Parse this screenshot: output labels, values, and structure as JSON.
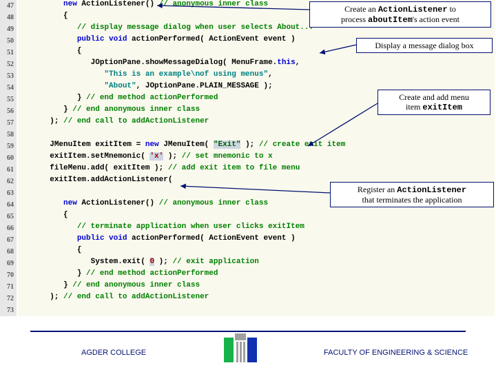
{
  "gutter": {
    "start": 47,
    "end": 73
  },
  "code": {
    "47": [
      [
        "",
        10
      ],
      [
        "kw",
        "new"
      ],
      [
        "id",
        " ActionListener() "
      ],
      [
        "cm",
        "// anonymous inner class"
      ]
    ],
    "48": [
      [
        "",
        10
      ],
      [
        "pun",
        "{"
      ]
    ],
    "49": [
      [
        "",
        13
      ],
      [
        "cm",
        "// display message dialog when user selects About..."
      ]
    ],
    "50": [
      [
        "",
        13
      ],
      [
        "kw",
        "public void"
      ],
      [
        "id",
        " actionPerformed( ActionEvent event )"
      ]
    ],
    "51": [
      [
        "",
        13
      ],
      [
        "pun",
        "{"
      ]
    ],
    "52": [
      [
        "",
        16
      ],
      [
        "id",
        "JOptionPane.showMessageDialog( MenuFrame."
      ],
      [
        "kw",
        "this"
      ],
      [
        "pun",
        ","
      ]
    ],
    "53": [
      [
        "",
        19
      ],
      [
        "str",
        "\"This is an example\\nof using menus\""
      ],
      [
        "pun",
        ","
      ]
    ],
    "54": [
      [
        "",
        19
      ],
      [
        "str",
        "\"About\""
      ],
      [
        "pun",
        ", JOptionPane.PLAIN_MESSAGE );"
      ]
    ],
    "55": [
      [
        "",
        13
      ],
      [
        "pun",
        "} "
      ],
      [
        "cm",
        "// end method actionPerformed"
      ]
    ],
    "56": [
      [
        "",
        10
      ],
      [
        "pun",
        "} "
      ],
      [
        "cm",
        "// end anonymous inner class"
      ]
    ],
    "57": [
      [
        "",
        7
      ],
      [
        "pun",
        "); "
      ],
      [
        "cm",
        "// end call to addActionListener"
      ]
    ],
    "58": [
      [
        "",
        0
      ]
    ],
    "59": [
      [
        "",
        7
      ],
      [
        "id",
        "JMenuItem exitItem = "
      ],
      [
        "kw",
        "new"
      ],
      [
        "id",
        " JMenuItem( "
      ],
      [
        "hlg",
        "\"Exit\""
      ],
      [
        "id",
        " ); "
      ],
      [
        "cm",
        "// create exit item"
      ]
    ],
    "60": [
      [
        "",
        7
      ],
      [
        "id",
        "exitItem.setMnemonic( "
      ],
      [
        "hl",
        "'x'"
      ],
      [
        "id",
        " ); "
      ],
      [
        "cm",
        "// set mnemonic to x"
      ]
    ],
    "61": [
      [
        "",
        7
      ],
      [
        "id",
        "fileMenu.add( exitItem ); "
      ],
      [
        "cm",
        "// add exit item to file menu"
      ]
    ],
    "62": [
      [
        "",
        7
      ],
      [
        "id",
        "exitItem.addActionListener("
      ]
    ],
    "63": [
      [
        "",
        0
      ]
    ],
    "64": [
      [
        "",
        10
      ],
      [
        "kw",
        "new"
      ],
      [
        "id",
        " ActionListener() "
      ],
      [
        "cm",
        "// anonymous inner class"
      ]
    ],
    "65": [
      [
        "",
        10
      ],
      [
        "pun",
        "{"
      ]
    ],
    "66": [
      [
        "",
        13
      ],
      [
        "cm",
        "// terminate application when user clicks exitItem"
      ]
    ],
    "67": [
      [
        "",
        13
      ],
      [
        "kw",
        "public void"
      ],
      [
        "id",
        " actionPerformed( ActionEvent event )"
      ]
    ],
    "68": [
      [
        "",
        13
      ],
      [
        "pun",
        "{"
      ]
    ],
    "69": [
      [
        "",
        16
      ],
      [
        "id",
        "System.exit( "
      ],
      [
        "hl",
        "0"
      ],
      [
        "id",
        " ); "
      ],
      [
        "cm",
        "// exit application"
      ]
    ],
    "70": [
      [
        "",
        13
      ],
      [
        "pun",
        "} "
      ],
      [
        "cm",
        "// end method actionPerformed"
      ]
    ],
    "71": [
      [
        "",
        10
      ],
      [
        "pun",
        "} "
      ],
      [
        "cm",
        "// end anonymous inner class"
      ]
    ],
    "72": [
      [
        "",
        7
      ],
      [
        "pun",
        "); "
      ],
      [
        "cm",
        "// end call to addActionListener"
      ]
    ],
    "73": [
      [
        "",
        0
      ]
    ]
  },
  "callouts": {
    "c1a": "Create an ",
    "c1b": "ActionListener",
    "c1c": " to",
    "c1d": "process ",
    "c1e": "aboutItem",
    "c1f": "'s action event",
    "c2": "Display a message dialog box",
    "c3a": "Create and add menu",
    "c3b": "item ",
    "c3c": "exitItem",
    "c4a": "Register an ",
    "c4b": "ActionListener",
    "c4c": "that terminates the application"
  },
  "footer": {
    "left": "AGDER COLLEGE",
    "right": "FACULTY OF ENGINEERING & SCIENCE"
  }
}
